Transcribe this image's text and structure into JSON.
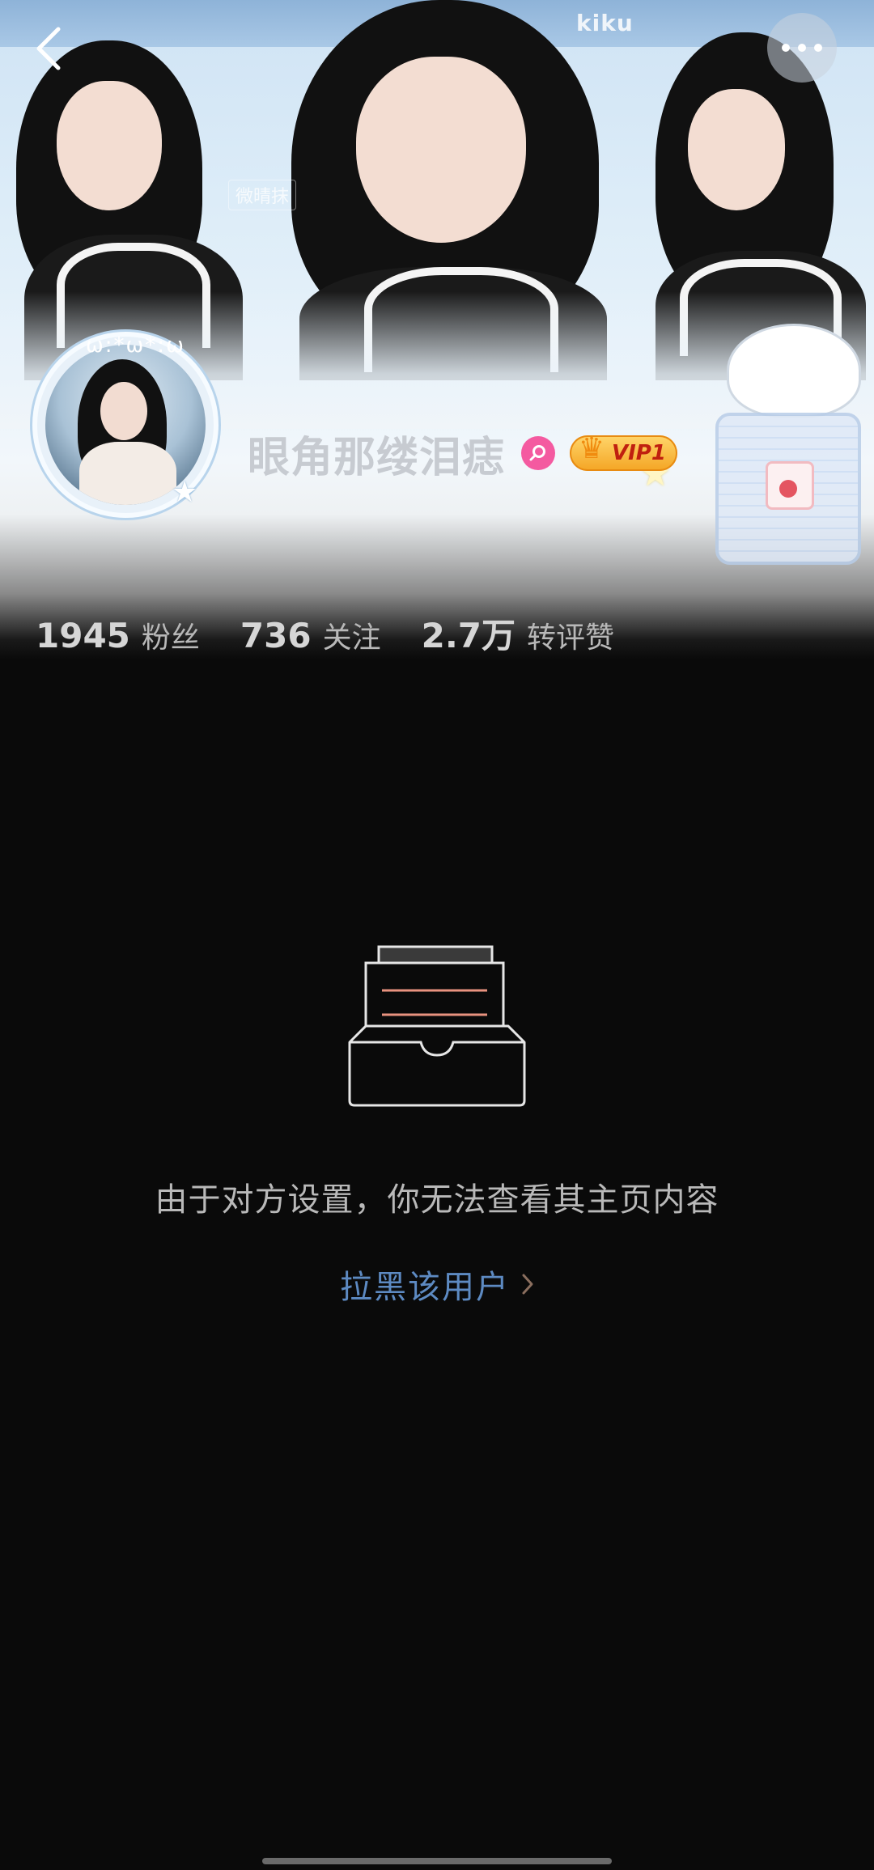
{
  "banner": {
    "brand_tag": "kiku",
    "watermark": "微晴抹"
  },
  "header": {
    "back_icon": "chevron-left-icon",
    "more_icon": "more-dots-icon"
  },
  "profile": {
    "nickname": "眼角那缕泪痣",
    "gender_icon": "female-icon",
    "gender_color": "#f45aa0",
    "vip_label": "VIP1",
    "avatar_deco": "ω:*ω*:ω"
  },
  "stats": [
    {
      "value": "1945",
      "label": "粉丝"
    },
    {
      "value": "736",
      "label": "关注"
    },
    {
      "value": "2.7万",
      "label": "转评赞"
    }
  ],
  "empty_state": {
    "icon": "empty-box-icon",
    "message": "由于对方设置，你无法查看其主页内容",
    "block_link_label": "拉黑该用户",
    "link_color": "#5d8ac2"
  },
  "theme": {
    "background": "#0a0a0a"
  }
}
